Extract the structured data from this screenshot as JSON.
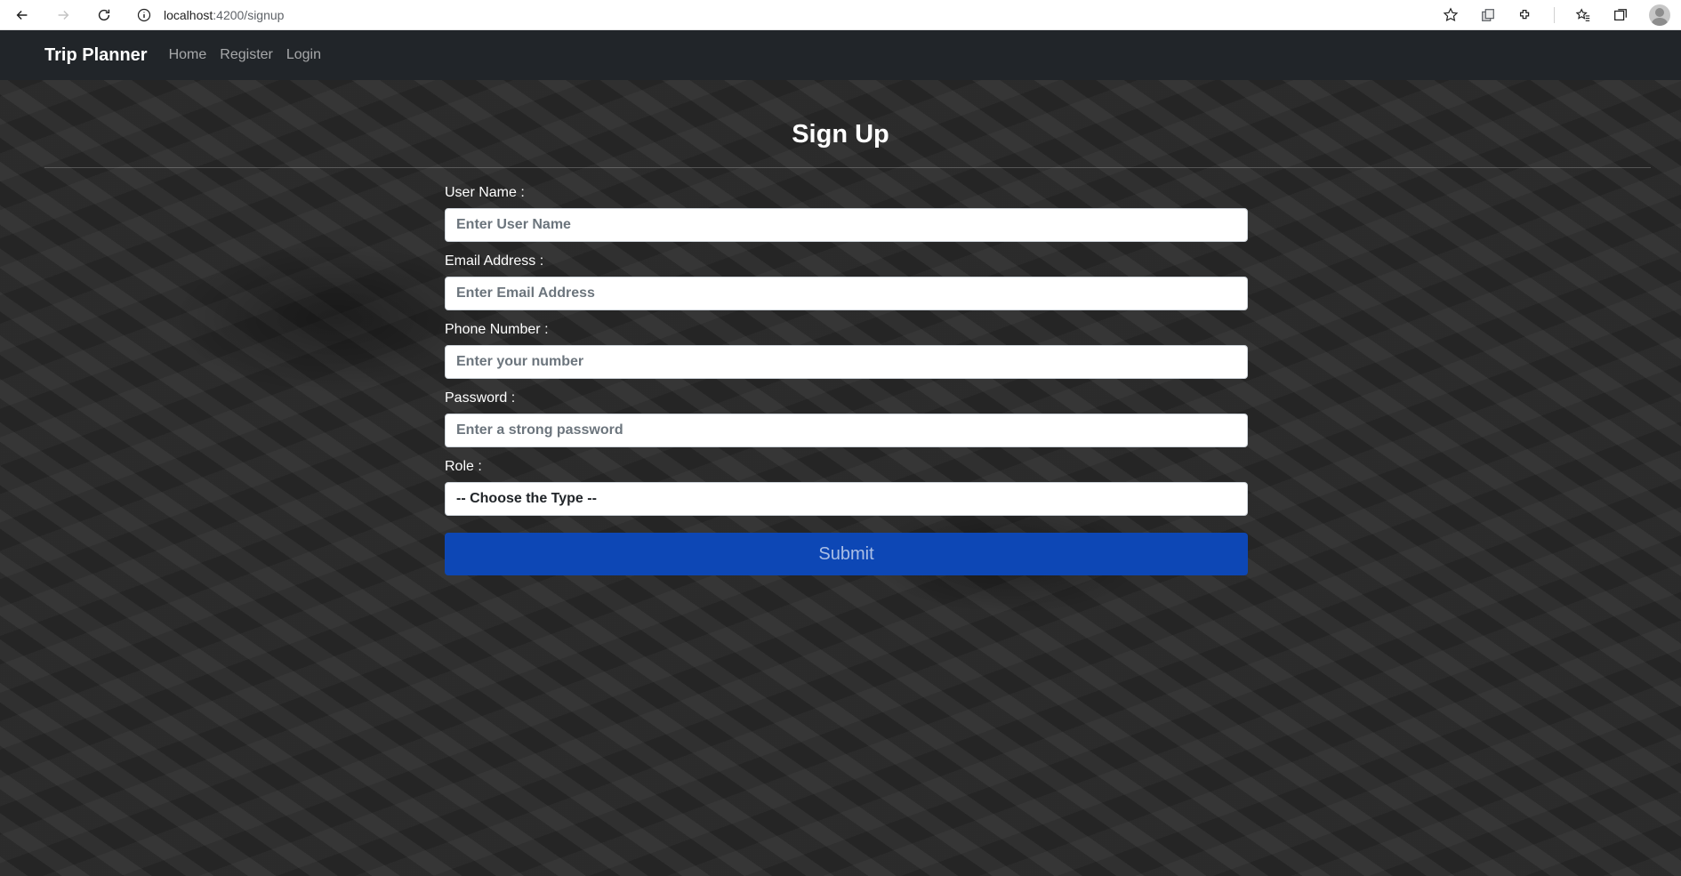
{
  "browser": {
    "url_host": "localhost",
    "url_path": ":4200/signup"
  },
  "navbar": {
    "brand": "Trip Planner",
    "links": [
      "Home",
      "Register",
      "Login"
    ]
  },
  "page": {
    "title": "Sign Up"
  },
  "form": {
    "username": {
      "label": "User Name :",
      "placeholder": "Enter User Name"
    },
    "email": {
      "label": "Email Address :",
      "placeholder": "Enter Email Address"
    },
    "phone": {
      "label": "Phone Number :",
      "placeholder": "Enter your number"
    },
    "password": {
      "label": "Password :",
      "placeholder": "Enter a strong password"
    },
    "role": {
      "label": "Role :",
      "selected": "-- Choose the Type --"
    },
    "submit_label": "Submit"
  },
  "colors": {
    "navbar_bg": "#212529",
    "submit_bg": "#0d47b5"
  }
}
